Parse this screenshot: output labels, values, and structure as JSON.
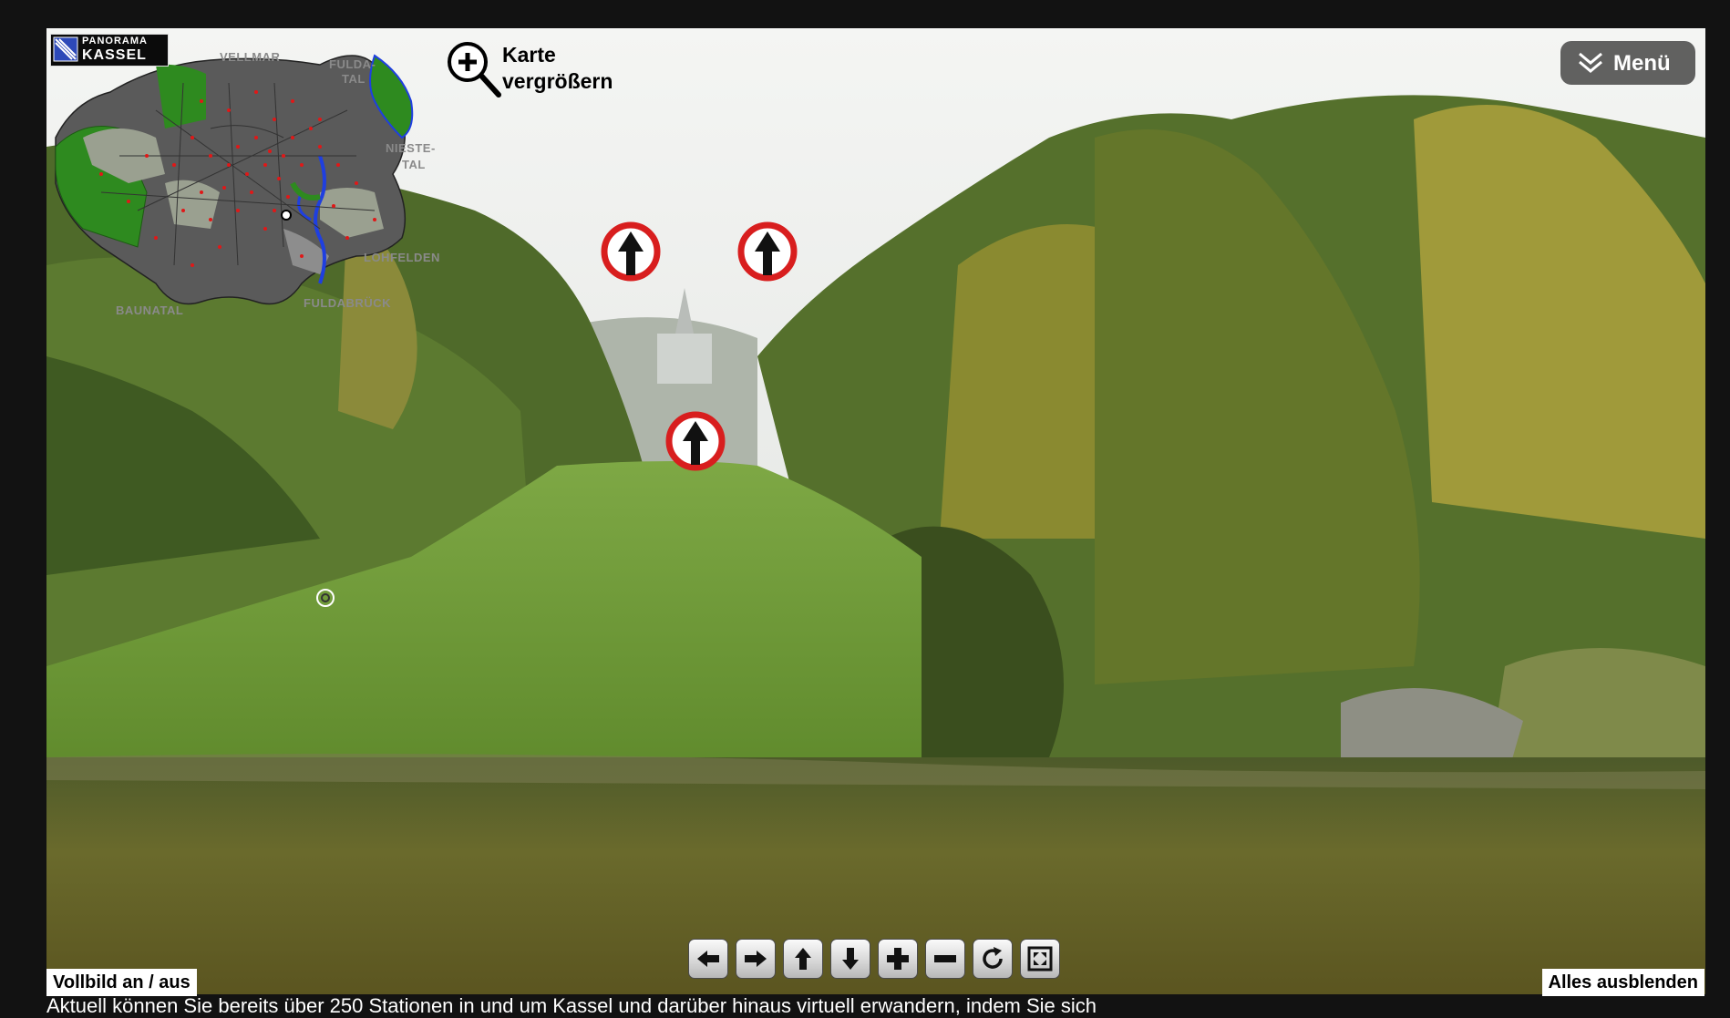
{
  "app": {
    "name": "Panorama Kassel"
  },
  "map": {
    "logo_top": "PANORAMA",
    "logo_bottom": "KASSEL",
    "labels": {
      "vellmar": "VELLMAR",
      "fulda_tal_1": "FULDA-",
      "fulda_tal_2": "TAL",
      "nieste_tal_1": "NIESTE-",
      "nieste_tal_2": "TAL",
      "lohfelden": "LOHFELDEN",
      "fuldabrueck": "FULDABRÜCK",
      "baunatal": "BAUNATAL"
    },
    "enlarge_line1": "Karte",
    "enlarge_line2": "vergrößern"
  },
  "menu": {
    "label": "Menü"
  },
  "controls": [
    {
      "name": "pan-left-button",
      "icon": "arrow-left-icon"
    },
    {
      "name": "pan-right-button",
      "icon": "arrow-right-icon"
    },
    {
      "name": "pan-up-button",
      "icon": "arrow-up-icon"
    },
    {
      "name": "pan-down-button",
      "icon": "arrow-down-icon"
    },
    {
      "name": "zoom-in-button",
      "icon": "plus-icon"
    },
    {
      "name": "zoom-out-button",
      "icon": "minus-icon"
    },
    {
      "name": "autorotate-button",
      "icon": "rotate-icon"
    },
    {
      "name": "fullscreen-toggle-button",
      "icon": "expand-icon"
    }
  ],
  "buttons": {
    "fullscreen": "Vollbild an / aus",
    "hide_all": "Alles ausblenden"
  },
  "info_text": "Aktuell können Sie bereits über 250 Stationen in und um Kassel und darüber hinaus virtuell erwandern, indem Sie sich",
  "colors": {
    "hotspot_ring": "#d81e1e",
    "map_green": "#2e8a1f",
    "map_gray": "#5a5a5a",
    "river_blue": "#1f3fe0"
  }
}
